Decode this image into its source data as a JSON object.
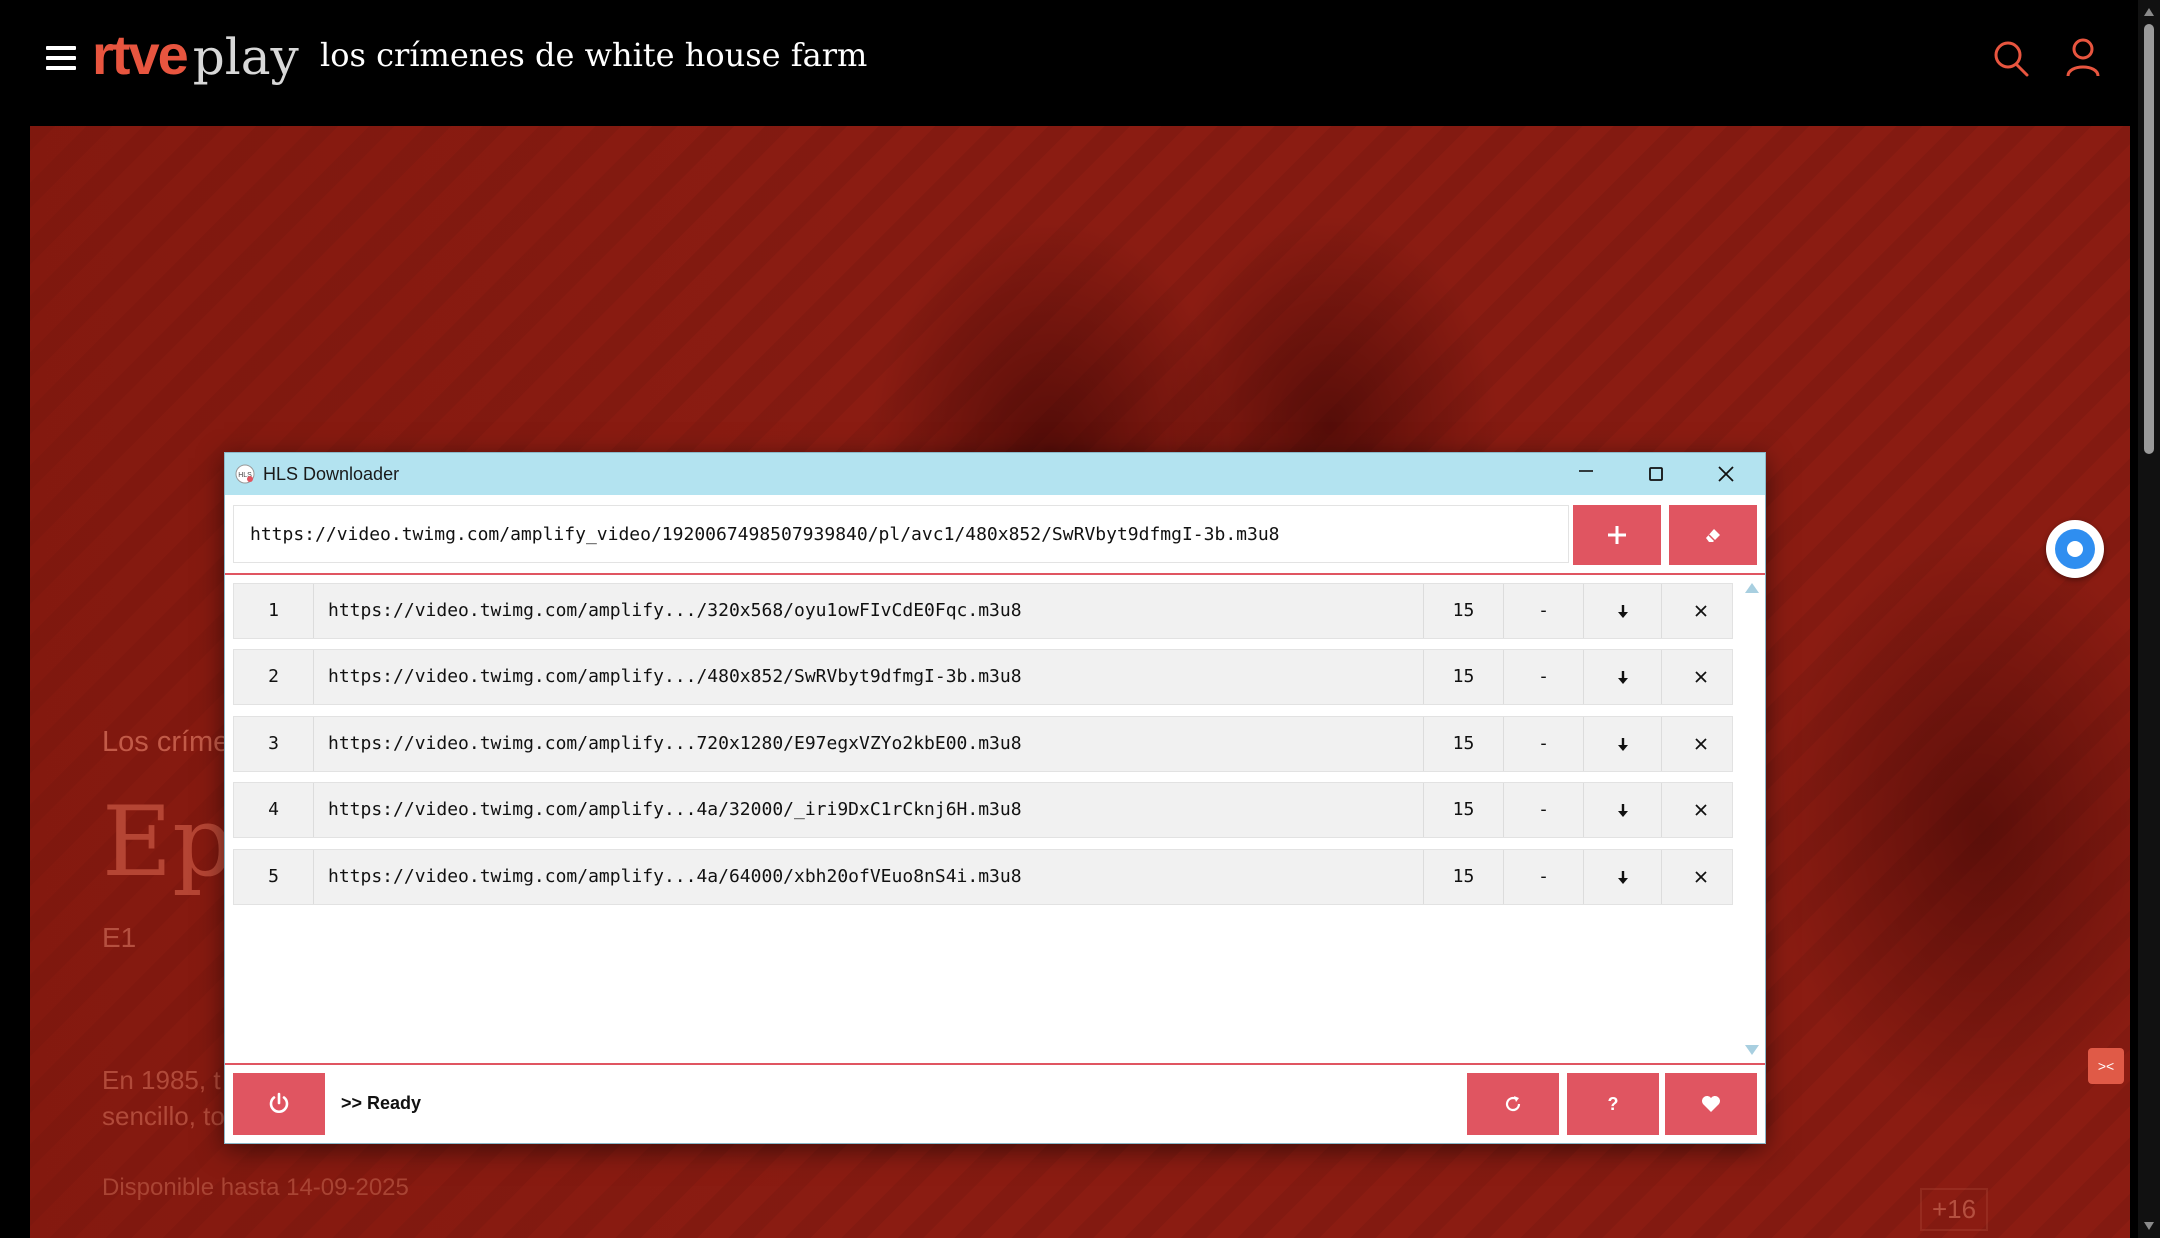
{
  "site": {
    "logo_rtve": "rtve",
    "logo_play": "play",
    "show_title": "los crímenes de white house farm"
  },
  "hero": {
    "subtitle": "Los críme",
    "title": "Epi",
    "episode": "E1",
    "description_line1": "En 1985, t",
    "description_line2": "sencillo, to",
    "availability": "Disponible hasta 14-09-2025",
    "rating": "+16"
  },
  "dialog": {
    "title": "HLS Downloader",
    "url_value": "https://video.twimg.com/amplify_video/1920067498507939840/pl/avc1/480x852/SwRVbyt9dfmgI-3b.m3u8",
    "status": ">> Ready",
    "rows": [
      {
        "index": "1",
        "url": "https://video.twimg.com/amplify.../320x568/oyu1owFIvCdE0Fqc.m3u8",
        "duration": "15",
        "sub": "-"
      },
      {
        "index": "2",
        "url": "https://video.twimg.com/amplify.../480x852/SwRVbyt9dfmgI-3b.m3u8",
        "duration": "15",
        "sub": "-"
      },
      {
        "index": "3",
        "url": "https://video.twimg.com/amplify...720x1280/E97egxVZYo2kbE00.m3u8",
        "duration": "15",
        "sub": "-"
      },
      {
        "index": "4",
        "url": "https://video.twimg.com/amplify...4a/32000/_iri9DxC1rCknj6H.m3u8",
        "duration": "15",
        "sub": "-"
      },
      {
        "index": "5",
        "url": "https://video.twimg.com/amplify...4a/64000/xbh20ofVEuo8nS4i.m3u8",
        "duration": "15",
        "sub": "-"
      }
    ],
    "help_label": "?"
  },
  "colors": {
    "accent": "#e05561",
    "titlebar": "#b3e3f0",
    "brand_red": "#e8553f",
    "hero_bg": "#8b1c12"
  },
  "icons": {
    "menu": "hamburger-menu-icon",
    "search": "search-icon",
    "user": "user-icon",
    "add": "plus-icon",
    "clear": "eraser-icon",
    "download": "download-arrow-icon",
    "remove": "close-x-icon",
    "power": "power-icon",
    "refresh": "refresh-icon",
    "heart": "heart-icon"
  }
}
